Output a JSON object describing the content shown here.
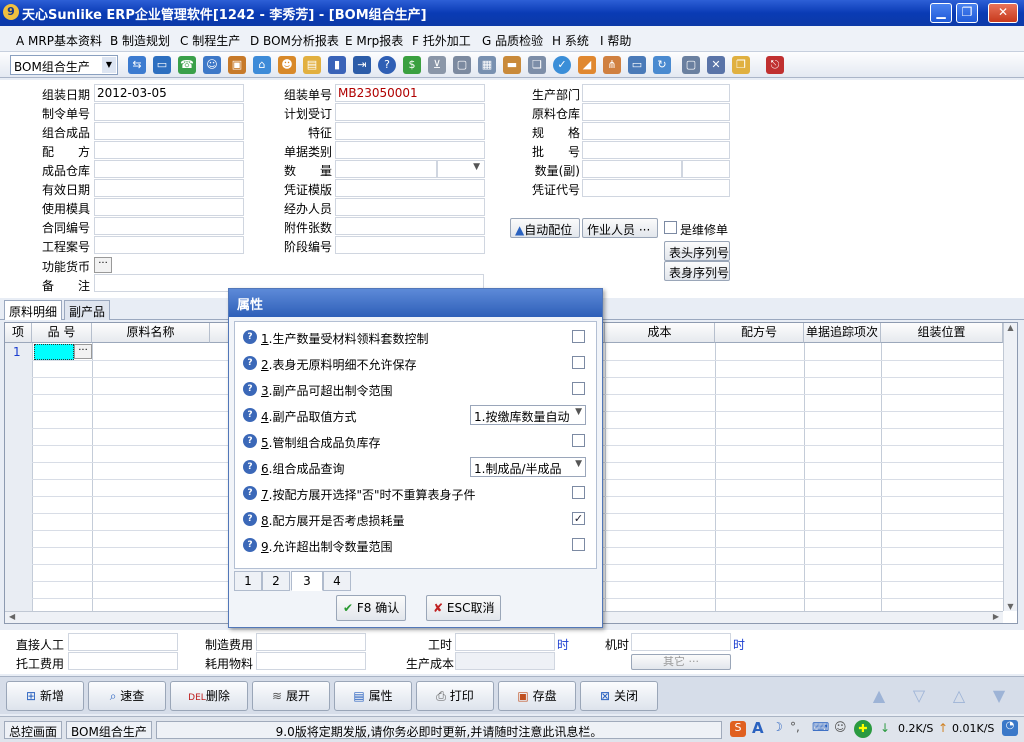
{
  "window": {
    "title": "天心Sunlike ERP企业管理软件[1242 - 李秀芳] - [BOM组合生产]"
  },
  "menu": [
    "A MRP基本资料",
    "B 制造规划",
    "C 制程生产",
    "D BOM分析报表",
    "E Mrp报表",
    "F 托外加工",
    "G 品质检验",
    "H 系统",
    "I 帮助"
  ],
  "toolbar": {
    "selector": "BOM组合生产"
  },
  "form": {
    "col1": [
      {
        "label": "组装日期",
        "value": "2012-03-05"
      },
      {
        "label": "制令单号",
        "value": ""
      },
      {
        "label": "组合成品",
        "value": ""
      },
      {
        "label": "配　　方",
        "value": ""
      },
      {
        "label": "成品仓库",
        "value": ""
      },
      {
        "label": "有效日期",
        "value": ""
      },
      {
        "label": "使用模具",
        "value": ""
      },
      {
        "label": "合同编号",
        "value": ""
      },
      {
        "label": "工程案号",
        "value": ""
      }
    ],
    "col2": [
      {
        "label": "组装单号",
        "value": "MB23050001"
      },
      {
        "label": "计划受订",
        "value": ""
      },
      {
        "label": "特征",
        "value": ""
      },
      {
        "label": "单据类别",
        "value": ""
      },
      {
        "label": "数　　量",
        "value": ""
      },
      {
        "label": "凭证模版",
        "value": ""
      },
      {
        "label": "经办人员",
        "value": ""
      },
      {
        "label": "附件张数",
        "value": ""
      },
      {
        "label": "阶段编号",
        "value": ""
      }
    ],
    "col3": [
      {
        "label": "生产部门",
        "value": ""
      },
      {
        "label": "原料仓库",
        "value": ""
      },
      {
        "label": "规　　格",
        "value": ""
      },
      {
        "label": "批　　号",
        "value": ""
      },
      {
        "label": "数量(副)",
        "value": ""
      },
      {
        "label": "凭证代号",
        "value": ""
      }
    ],
    "currency_label": "功能货币",
    "remark_label": "备　　注",
    "auto_alloc": "自动配位",
    "workers": "作业人员",
    "repair_label": "是维修单",
    "head_serial": "表头序列号",
    "body_serial": "表身序列号"
  },
  "tabs": [
    "原料明细",
    "副产品"
  ],
  "grid": {
    "headers": [
      "项",
      "品 号",
      "原料名称",
      "成本",
      "配方号",
      "单据追踪项次",
      "组装位置"
    ],
    "first_row": "1"
  },
  "footer": {
    "direct_labor": "直接人工",
    "manufacturing_cost": "制造费用",
    "work_hours": "工时",
    "machine_hours": "机时",
    "hour_unit": "时",
    "outsourcing_cost": "托工费用",
    "material_usage": "耗用物料",
    "production_cost": "生产成本",
    "other": "其它 ···"
  },
  "buttons": [
    "新增",
    "速查",
    "删除",
    "展开",
    "属性",
    "打印",
    "存盘",
    "关闭"
  ],
  "status": {
    "home": "总控画面",
    "current": "BOM组合生产",
    "message": "9.0版将定期发版,请你务必即时更新,并请随时注意此讯息栏。",
    "down": "0.2K/S",
    "up": "0.01K/S"
  },
  "dialog": {
    "title": "属性",
    "items": [
      {
        "num": "1",
        "label": ".生产数量受材料领料套数控制",
        "checked": false
      },
      {
        "num": "2",
        "label": ".表身无原料明细不允许保存",
        "checked": false
      },
      {
        "num": "3",
        "label": ".副产品可超出制令范围",
        "checked": false
      },
      {
        "num": "4",
        "label": ".副产品取值方式",
        "dropdown": "1.按缴库数量自动"
      },
      {
        "num": "5",
        "label": ".管制组合成品负库存",
        "checked": false
      },
      {
        "num": "6",
        "label": ".组合成品查询",
        "dropdown": "1.制成品/半成品"
      },
      {
        "num": "7",
        "label": ".按配方展开选择\"否\"时不重算表身子件",
        "checked": false
      },
      {
        "num": "8",
        "label": ".配方展开是否考虑损耗量",
        "checked": true
      },
      {
        "num": "9",
        "label": ".允许超出制令数量范围",
        "checked": false
      }
    ],
    "pages": [
      "1",
      "2",
      "3",
      "4"
    ],
    "active_page": "3",
    "confirm": "F8 确认",
    "cancel": "ESC取消"
  }
}
